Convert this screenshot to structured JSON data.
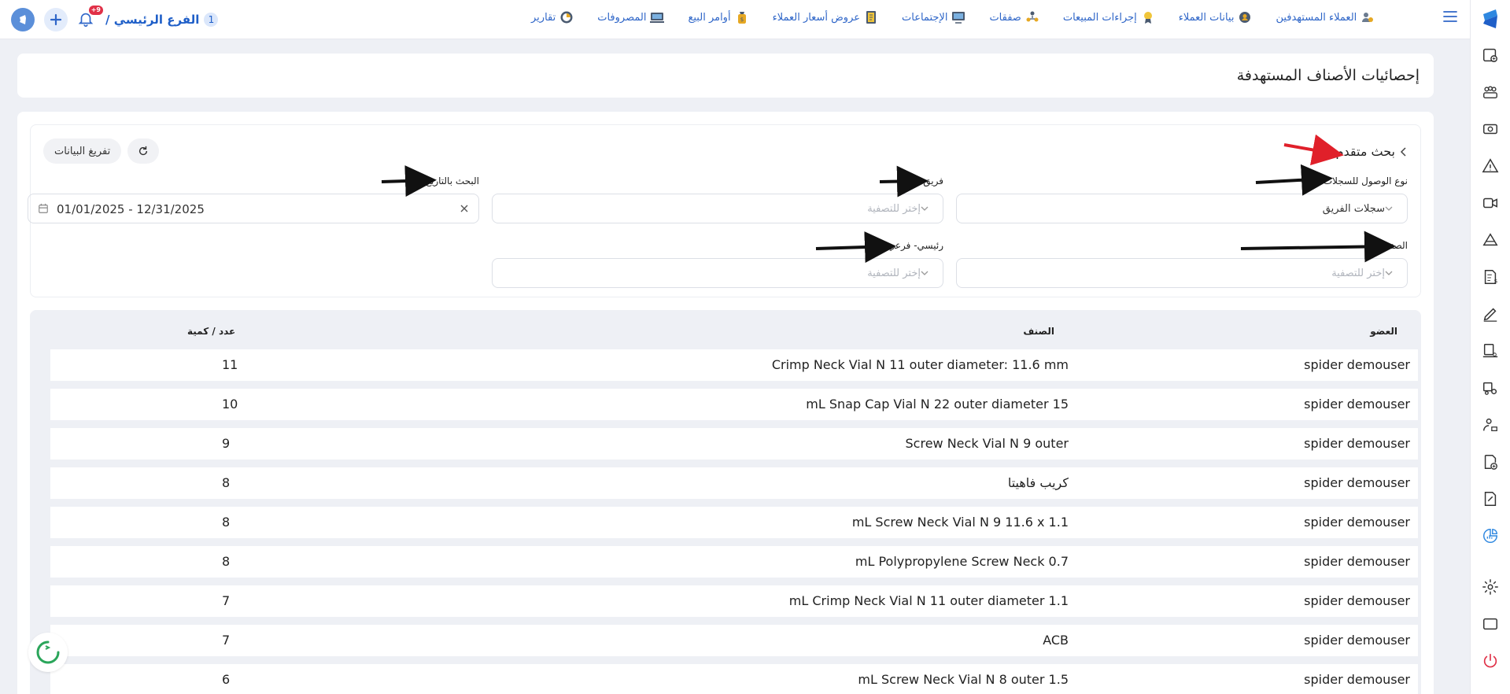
{
  "topbar": {
    "branch_number": "1",
    "branch_name": "الفرع الرئيسي /",
    "notification_count": "+9",
    "nav": [
      {
        "label": "العملاء المستهدفين",
        "icon": "target-users-icon"
      },
      {
        "label": "بيانات العملاء",
        "icon": "client-data-icon"
      },
      {
        "label": "إجراءات المبيعات",
        "icon": "sales-actions-icon"
      },
      {
        "label": "صفقات",
        "icon": "deals-icon"
      },
      {
        "label": "الإجتماعات",
        "icon": "meetings-icon"
      },
      {
        "label": "عروض أسعار العملاء",
        "icon": "quotes-icon"
      },
      {
        "label": "أوامر البيع",
        "icon": "sales-orders-icon"
      },
      {
        "label": "المصروفات",
        "icon": "expenses-icon"
      },
      {
        "label": "تقارير",
        "icon": "reports-icon"
      }
    ]
  },
  "page": {
    "title": "إحصائيات الأصناف المستهدفة"
  },
  "filters": {
    "advanced_search": "بحث متقدم",
    "export_button": "تفريغ البيانات",
    "access_type": {
      "label": "نوع الوصول للسجلات",
      "value": "سجلات الفريق"
    },
    "team": {
      "label": "فريق",
      "placeholder": "إختر للتصفية"
    },
    "date": {
      "label": "البحث بالتاريخ",
      "value": "01/01/2025 - 12/31/2025"
    },
    "item": {
      "label": "الصنف",
      "placeholder": "إختر للتصفية"
    },
    "main_sub": {
      "label": "رئيسي- فرعي",
      "placeholder": "إختر للتصفية"
    }
  },
  "table": {
    "headers": {
      "member": "العضو",
      "item": "الصنف",
      "qty": "عدد / كمية"
    },
    "rows": [
      {
        "member": "spider demouser",
        "item": "Crimp Neck Vial N 11 outer diameter: 11.6 mm",
        "qty": "11"
      },
      {
        "member": "spider demouser",
        "item": "mL Snap Cap Vial N 22 outer diameter 15",
        "qty": "10"
      },
      {
        "member": "spider demouser",
        "item": "Screw Neck Vial N 9 outer",
        "qty": "9"
      },
      {
        "member": "spider demouser",
        "item": "كريب فاهيتا",
        "qty": "8"
      },
      {
        "member": "spider demouser",
        "item": "mL Screw Neck Vial N 9 11.6 x 1.1",
        "qty": "8"
      },
      {
        "member": "spider demouser",
        "item": "mL Polypropylene Screw Neck 0.7",
        "qty": "8"
      },
      {
        "member": "spider demouser",
        "item": "mL Crimp Neck Vial N 11 outer diameter 1.1",
        "qty": "7"
      },
      {
        "member": "spider demouser",
        "item": "ACB",
        "qty": "7"
      },
      {
        "member": "spider demouser",
        "item": "mL Screw Neck Vial N 8 outer 1.5",
        "qty": "6"
      }
    ]
  },
  "colors": {
    "primary": "#2f66c8",
    "badge": "#e03047",
    "arrow_red": "#e0202a"
  }
}
